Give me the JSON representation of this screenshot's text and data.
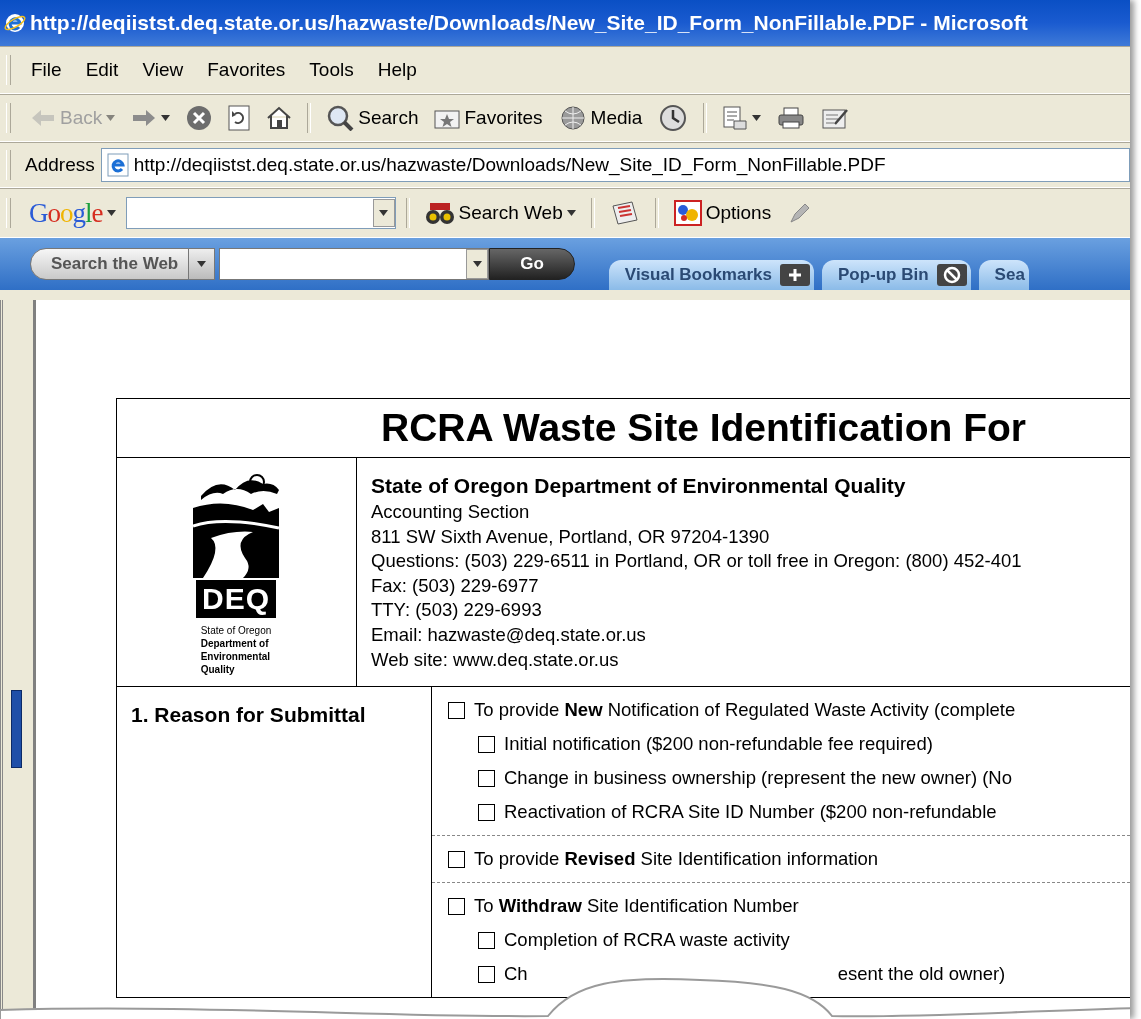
{
  "window": {
    "title": "http://deqiistst.deq.state.or.us/hazwaste/Downloads/New_Site_ID_Form_NonFillable.PDF - Microsoft"
  },
  "menu": [
    "File",
    "Edit",
    "View",
    "Favorites",
    "Tools",
    "Help"
  ],
  "toolbar": [
    {
      "label": "Back",
      "disabled": true
    },
    {
      "disabled": false
    },
    {
      "disabled": false
    },
    {
      "disabled": false
    },
    {
      "disabled": false
    },
    {
      "label": "Search",
      "disabled": false
    },
    {
      "label": "Favorites",
      "disabled": false
    },
    {
      "label": "Media",
      "disabled": false
    },
    {
      "disabled": false
    },
    {
      "disabled": false
    },
    {
      "disabled": false
    },
    {
      "disabled": false
    }
  ],
  "address": {
    "label": "Address",
    "value": "http://deqiistst.deq.state.or.us/hazwaste/Downloads/New_Site_ID_Form_NonFillable.PDF"
  },
  "google_bar": {
    "logo": "Google",
    "search_button": "Search Web",
    "options_button": "Options"
  },
  "search_bar": {
    "menu_button": "Search the Web",
    "go_button": "Go",
    "tabs": [
      {
        "label": "Visual Bookmarks"
      },
      {
        "label": "Pop-up Bin"
      },
      {
        "label": "Sea"
      }
    ]
  },
  "document": {
    "title": "RCRA Waste Site Identification For",
    "logo": {
      "mark": "DEQ",
      "caption": [
        "State of Oregon",
        "Department of",
        "Environmental",
        "Quality"
      ]
    },
    "org_name": "State of Oregon Department of Environmental Quality",
    "contact_lines": [
      "Accounting Section",
      "811 SW Sixth Avenue, Portland, OR 97204-1390",
      "Questions: (503) 229-6511 in Portland, OR or toll free in Oregon: (800) 452-401",
      "Fax: (503) 229-6977",
      "TTY: (503) 229-6993",
      "Email: hazwaste@deq.state.or.us",
      "Web site: www.deq.state.or.us"
    ],
    "section": {
      "heading": "1. Reason for Submittal",
      "groups": [
        {
          "text": "To provide **New** Notification of Regulated Waste Activity (complete",
          "checked": false,
          "children": [
            {
              "text": "Initial notification ($200 non-refundable fee required)",
              "checked": false
            },
            {
              "text": "Change in business ownership (represent the new owner) (No",
              "checked": false
            },
            {
              "text": "Reactivation of RCRA Site ID Number ($200 non-refundable",
              "checked": false
            }
          ]
        },
        {
          "text": "To provide **Revised** Site Identification information",
          "checked": false
        },
        {
          "text": "To **Withdraw** Site Identification Number",
          "checked": false,
          "children": [
            {
              "text": "Completion of RCRA waste activity",
              "checked": false
            },
            {
              "fragments": [
                "Ch",
                "esent the old owner)"
              ],
              "checked": false
            }
          ]
        }
      ]
    }
  }
}
